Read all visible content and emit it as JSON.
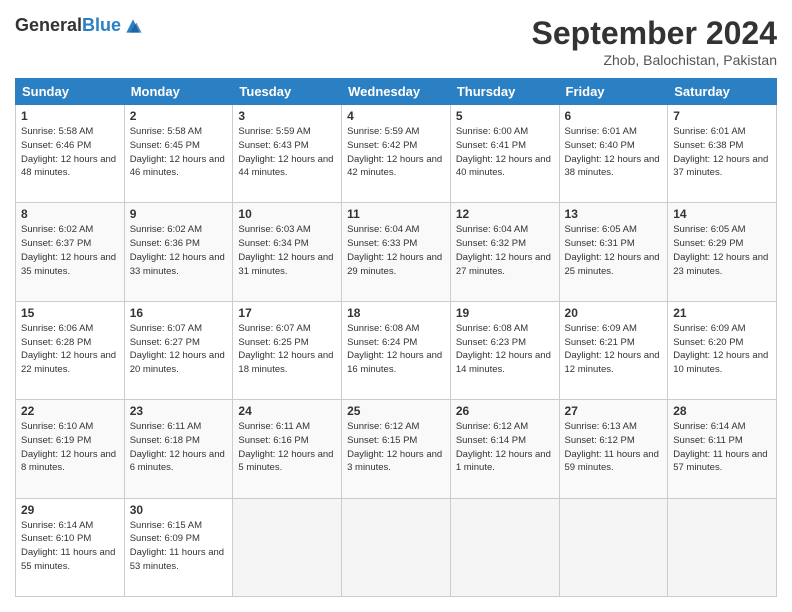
{
  "logo": {
    "general": "General",
    "blue": "Blue"
  },
  "header": {
    "month_year": "September 2024",
    "location": "Zhob, Balochistan, Pakistan"
  },
  "days_of_week": [
    "Sunday",
    "Monday",
    "Tuesday",
    "Wednesday",
    "Thursday",
    "Friday",
    "Saturday"
  ],
  "weeks": [
    [
      {
        "day": "1",
        "sunrise": "5:58 AM",
        "sunset": "6:46 PM",
        "daylight": "12 hours and 48 minutes."
      },
      {
        "day": "2",
        "sunrise": "5:58 AM",
        "sunset": "6:45 PM",
        "daylight": "12 hours and 46 minutes."
      },
      {
        "day": "3",
        "sunrise": "5:59 AM",
        "sunset": "6:43 PM",
        "daylight": "12 hours and 44 minutes."
      },
      {
        "day": "4",
        "sunrise": "5:59 AM",
        "sunset": "6:42 PM",
        "daylight": "12 hours and 42 minutes."
      },
      {
        "day": "5",
        "sunrise": "6:00 AM",
        "sunset": "6:41 PM",
        "daylight": "12 hours and 40 minutes."
      },
      {
        "day": "6",
        "sunrise": "6:01 AM",
        "sunset": "6:40 PM",
        "daylight": "12 hours and 38 minutes."
      },
      {
        "day": "7",
        "sunrise": "6:01 AM",
        "sunset": "6:38 PM",
        "daylight": "12 hours and 37 minutes."
      }
    ],
    [
      {
        "day": "8",
        "sunrise": "6:02 AM",
        "sunset": "6:37 PM",
        "daylight": "12 hours and 35 minutes."
      },
      {
        "day": "9",
        "sunrise": "6:02 AM",
        "sunset": "6:36 PM",
        "daylight": "12 hours and 33 minutes."
      },
      {
        "day": "10",
        "sunrise": "6:03 AM",
        "sunset": "6:34 PM",
        "daylight": "12 hours and 31 minutes."
      },
      {
        "day": "11",
        "sunrise": "6:04 AM",
        "sunset": "6:33 PM",
        "daylight": "12 hours and 29 minutes."
      },
      {
        "day": "12",
        "sunrise": "6:04 AM",
        "sunset": "6:32 PM",
        "daylight": "12 hours and 27 minutes."
      },
      {
        "day": "13",
        "sunrise": "6:05 AM",
        "sunset": "6:31 PM",
        "daylight": "12 hours and 25 minutes."
      },
      {
        "day": "14",
        "sunrise": "6:05 AM",
        "sunset": "6:29 PM",
        "daylight": "12 hours and 23 minutes."
      }
    ],
    [
      {
        "day": "15",
        "sunrise": "6:06 AM",
        "sunset": "6:28 PM",
        "daylight": "12 hours and 22 minutes."
      },
      {
        "day": "16",
        "sunrise": "6:07 AM",
        "sunset": "6:27 PM",
        "daylight": "12 hours and 20 minutes."
      },
      {
        "day": "17",
        "sunrise": "6:07 AM",
        "sunset": "6:25 PM",
        "daylight": "12 hours and 18 minutes."
      },
      {
        "day": "18",
        "sunrise": "6:08 AM",
        "sunset": "6:24 PM",
        "daylight": "12 hours and 16 minutes."
      },
      {
        "day": "19",
        "sunrise": "6:08 AM",
        "sunset": "6:23 PM",
        "daylight": "12 hours and 14 minutes."
      },
      {
        "day": "20",
        "sunrise": "6:09 AM",
        "sunset": "6:21 PM",
        "daylight": "12 hours and 12 minutes."
      },
      {
        "day": "21",
        "sunrise": "6:09 AM",
        "sunset": "6:20 PM",
        "daylight": "12 hours and 10 minutes."
      }
    ],
    [
      {
        "day": "22",
        "sunrise": "6:10 AM",
        "sunset": "6:19 PM",
        "daylight": "12 hours and 8 minutes."
      },
      {
        "day": "23",
        "sunrise": "6:11 AM",
        "sunset": "6:18 PM",
        "daylight": "12 hours and 6 minutes."
      },
      {
        "day": "24",
        "sunrise": "6:11 AM",
        "sunset": "6:16 PM",
        "daylight": "12 hours and 5 minutes."
      },
      {
        "day": "25",
        "sunrise": "6:12 AM",
        "sunset": "6:15 PM",
        "daylight": "12 hours and 3 minutes."
      },
      {
        "day": "26",
        "sunrise": "6:12 AM",
        "sunset": "6:14 PM",
        "daylight": "12 hours and 1 minute."
      },
      {
        "day": "27",
        "sunrise": "6:13 AM",
        "sunset": "6:12 PM",
        "daylight": "11 hours and 59 minutes."
      },
      {
        "day": "28",
        "sunrise": "6:14 AM",
        "sunset": "6:11 PM",
        "daylight": "11 hours and 57 minutes."
      }
    ],
    [
      {
        "day": "29",
        "sunrise": "6:14 AM",
        "sunset": "6:10 PM",
        "daylight": "11 hours and 55 minutes."
      },
      {
        "day": "30",
        "sunrise": "6:15 AM",
        "sunset": "6:09 PM",
        "daylight": "11 hours and 53 minutes."
      },
      null,
      null,
      null,
      null,
      null
    ]
  ]
}
